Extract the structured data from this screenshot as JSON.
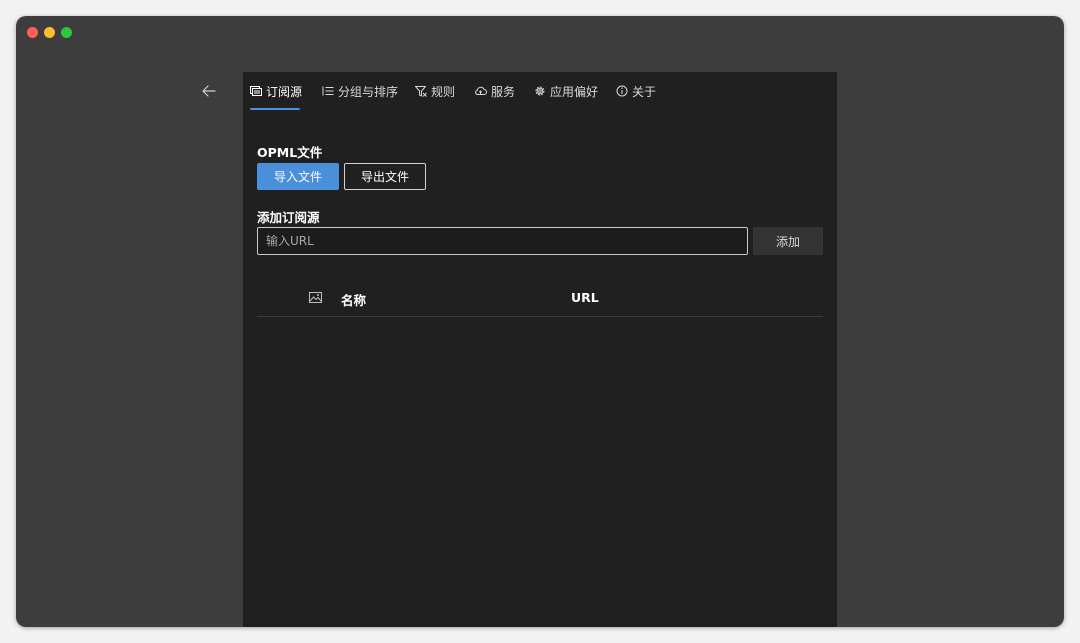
{
  "tabs": [
    {
      "label": "订阅源",
      "icon": "feeds-icon",
      "active": true
    },
    {
      "label": "分组与排序",
      "icon": "list-icon",
      "active": false
    },
    {
      "label": "规则",
      "icon": "filter-icon",
      "active": false
    },
    {
      "label": "服务",
      "icon": "cloud-icon",
      "active": false
    },
    {
      "label": "应用偏好",
      "icon": "gear-icon",
      "active": false
    },
    {
      "label": "关于",
      "icon": "info-icon",
      "active": false
    }
  ],
  "opml": {
    "label": "OPML文件",
    "import_label": "导入文件",
    "export_label": "导出文件"
  },
  "add_source": {
    "label": "添加订阅源",
    "placeholder": "输入URL",
    "value": "",
    "add_label": "添加"
  },
  "table": {
    "icon_column": "image-icon",
    "columns": [
      "名称",
      "URL"
    ]
  },
  "colors": {
    "accent": "#4a8fd9",
    "window_bg": "#3d3d3d",
    "panel_bg": "#202020"
  }
}
